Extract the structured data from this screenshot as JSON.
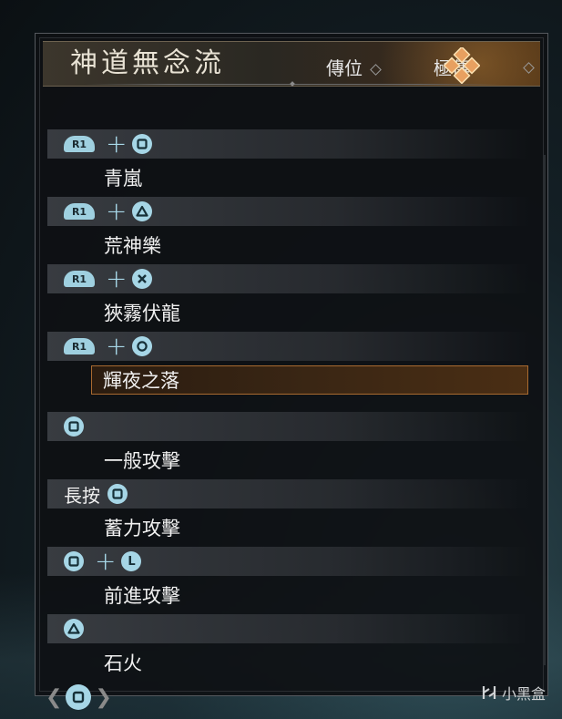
{
  "title": "神道無念流",
  "grades": [
    "傳位",
    "極傳"
  ],
  "moves": [
    {
      "input": [
        "R1",
        "+",
        "square"
      ],
      "name": "青嵐",
      "selected": false
    },
    {
      "input": [
        "R1",
        "+",
        "triangle"
      ],
      "name": "荒神樂",
      "selected": false
    },
    {
      "input": [
        "R1",
        "+",
        "cross"
      ],
      "name": "狹霧伏龍",
      "selected": false
    },
    {
      "input": [
        "R1",
        "+",
        "circle"
      ],
      "name": "輝夜之落",
      "selected": true
    },
    {
      "input": [
        "square"
      ],
      "name": "一般攻擊",
      "selected": false
    },
    {
      "input": [
        "長按",
        "square"
      ],
      "name": "蓄力攻擊",
      "selected": false
    },
    {
      "input": [
        "square",
        "+",
        "L-stick"
      ],
      "name": "前進攻擊",
      "selected": false
    },
    {
      "input": [
        "triangle"
      ],
      "name": "石火",
      "selected": false
    }
  ],
  "labels": {
    "r1": "R1",
    "hold": "長按",
    "stick": "L"
  },
  "watermark": "小黑盒",
  "colors": {
    "button": "#a6d6e6",
    "selected_border": "#a86a30"
  }
}
